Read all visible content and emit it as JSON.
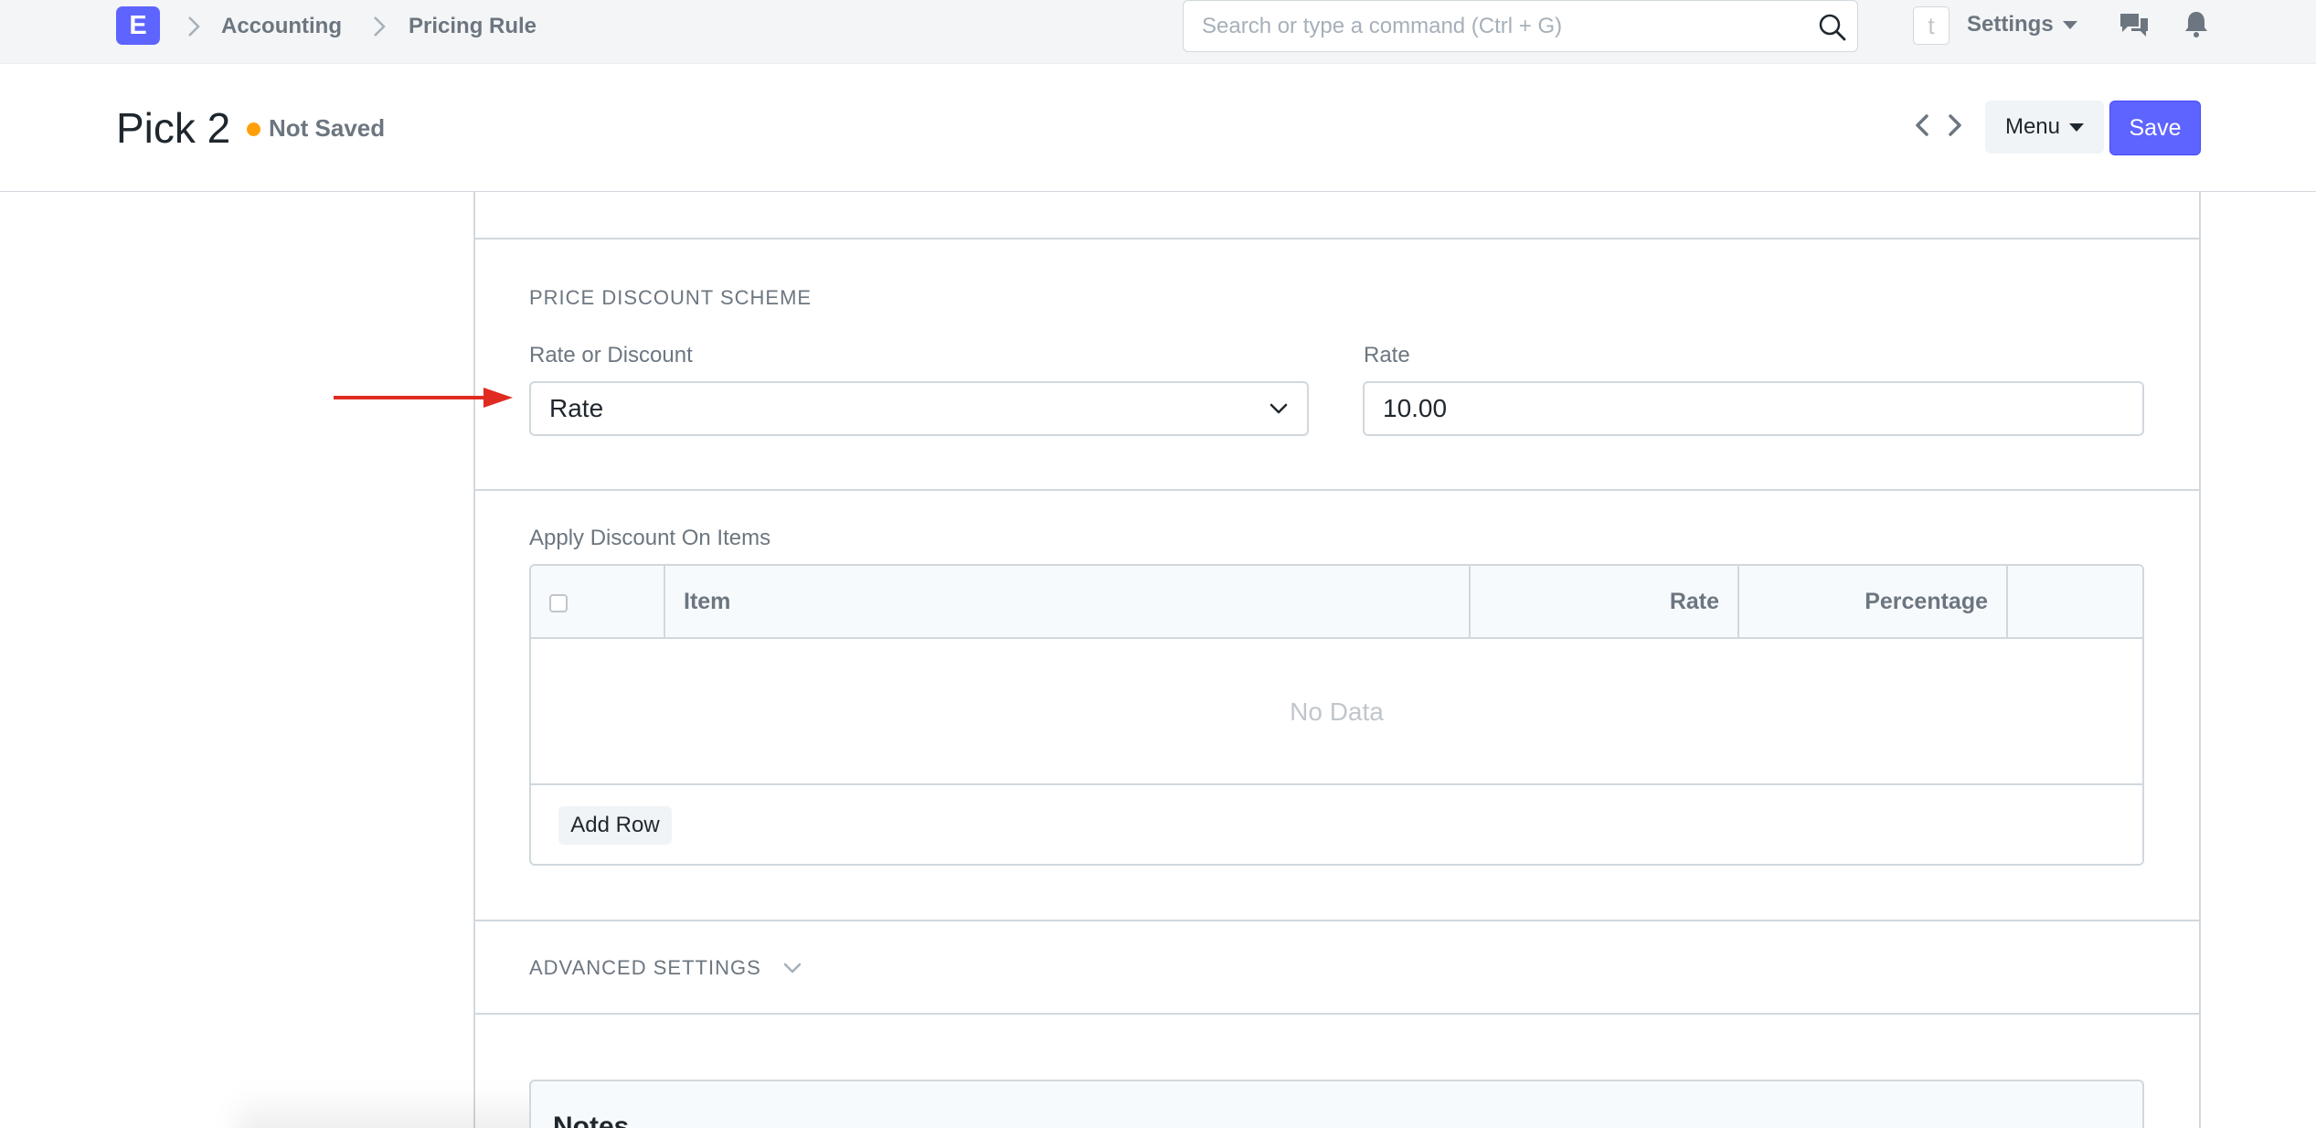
{
  "navbar": {
    "logo_letter": "E",
    "breadcrumbs": [
      "Accounting",
      "Pricing Rule"
    ],
    "search_placeholder": "Search or type a command (Ctrl + G)",
    "user_initial": "t",
    "settings_label": "Settings"
  },
  "page_head": {
    "title": "Pick 2",
    "status": "Not Saved",
    "menu_label": "Menu",
    "save_label": "Save"
  },
  "price_discount_scheme": {
    "section_title": "PRICE DISCOUNT SCHEME",
    "rate_or_discount_label": "Rate or Discount",
    "rate_or_discount_value": "Rate",
    "rate_label": "Rate",
    "rate_value": "10.00"
  },
  "apply_discount": {
    "label": "Apply Discount On Items",
    "columns": [
      "Item",
      "Rate",
      "Percentage"
    ],
    "empty_text": "No Data",
    "add_row_label": "Add Row"
  },
  "advanced_settings": {
    "title": "ADVANCED SETTINGS"
  },
  "notes": {
    "title": "Notes"
  },
  "colors": {
    "primary": "#5e64ff",
    "not_saved_indicator": "#ffa00a",
    "annotation_arrow": "#e02b20"
  }
}
